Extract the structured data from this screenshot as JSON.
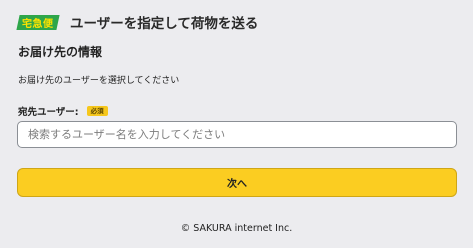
{
  "header": {
    "logo_text": "宅急便",
    "title": "ユーザーを指定して荷物を送る"
  },
  "main": {
    "section_title": "お届け先の情報",
    "instruction": "お届け先のユーザーを選択してください",
    "field": {
      "label": "宛先ユーザー:",
      "required_badge": "必須",
      "value": "",
      "placeholder": "検索するユーザー名を入力してください"
    },
    "next_button_label": "次へ"
  },
  "footer": {
    "copyright": "© SAKURA internet Inc."
  },
  "colors": {
    "background": "#ececef",
    "logo_green": "#2ea64a",
    "logo_yellow": "#ffe200",
    "accent_yellow": "#fbcd21",
    "badge_yellow": "#f6c71c"
  }
}
